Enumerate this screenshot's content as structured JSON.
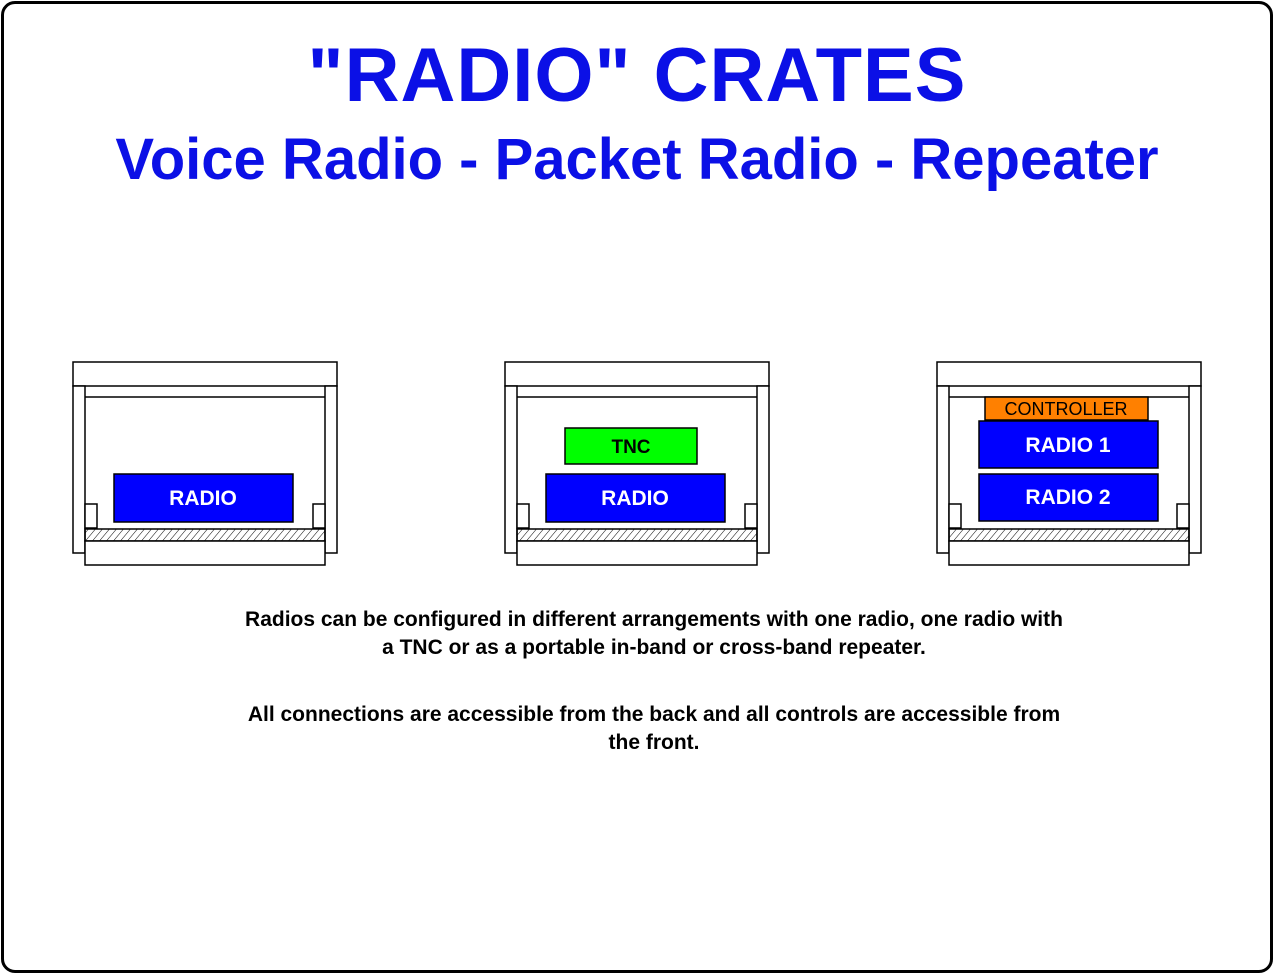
{
  "title": "\"RADIO\" CRATES",
  "subtitle": "Voice Radio - Packet Radio - Repeater",
  "crates": [
    {
      "modules": [
        {
          "label": "RADIO",
          "color": "#0000ff"
        }
      ]
    },
    {
      "modules": [
        {
          "label": "TNC",
          "color": "#00ff00"
        },
        {
          "label": "RADIO",
          "color": "#0000ff"
        }
      ]
    },
    {
      "modules": [
        {
          "label": "CONTROLLER",
          "color": "#ff8000"
        },
        {
          "label": "RADIO 1",
          "color": "#0000ff"
        },
        {
          "label": "RADIO 2",
          "color": "#0000ff"
        }
      ]
    }
  ],
  "captions": [
    "Radios can be configured in different arrangements with one radio, one radio with a TNC or as a portable in-band or cross-band repeater.",
    "All connections are accessible from the back and all controls are accessible from the front."
  ],
  "colors": {
    "title": "#0b10e6",
    "outline": "#000000"
  }
}
